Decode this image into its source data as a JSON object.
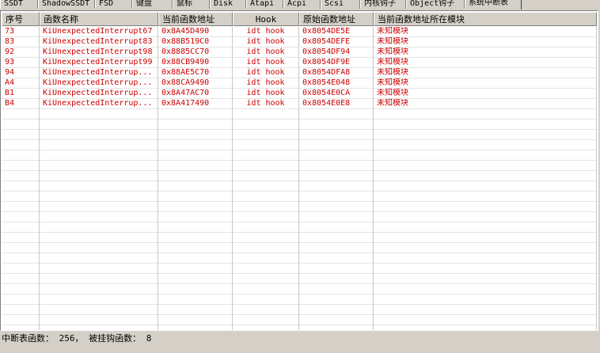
{
  "tabs": [
    {
      "label": "SSDT",
      "active": false
    },
    {
      "label": "ShadowSSDT",
      "active": false
    },
    {
      "label": "FSD",
      "active": false
    },
    {
      "label": "键盘",
      "active": false
    },
    {
      "label": "鼠标",
      "active": false
    },
    {
      "label": "Disk",
      "active": false
    },
    {
      "label": "Atapi",
      "active": false
    },
    {
      "label": "Acpi",
      "active": false
    },
    {
      "label": "Scsi",
      "active": false
    },
    {
      "label": "内核钩子",
      "active": false
    },
    {
      "label": "Object钩子",
      "active": false
    },
    {
      "label": "系统中断表",
      "active": true
    }
  ],
  "table": {
    "columns": [
      "序号",
      "函数名称",
      "当前函数地址",
      "Hook",
      "原始函数地址",
      "当前函数地址所在模块"
    ],
    "rows": [
      [
        "73",
        "KiUnexpectedInterrupt67",
        "0x8A45D490",
        "idt hook",
        "0x8054DE5E",
        "未知模块"
      ],
      [
        "83",
        "KiUnexpectedInterrupt83",
        "0x88B519C0",
        "idt hook",
        "0x8054DEFE",
        "未知模块"
      ],
      [
        "92",
        "KiUnexpectedInterrupt98",
        "0x8885CC70",
        "idt hook",
        "0x8054DF94",
        "未知模块"
      ],
      [
        "93",
        "KiUnexpectedInterrupt99",
        "0x88CB9490",
        "idt hook",
        "0x8054DF9E",
        "未知模块"
      ],
      [
        "94",
        "KiUnexpectedInterrup...",
        "0x88AE5C70",
        "idt hook",
        "0x8054DFA8",
        "未知模块"
      ],
      [
        "A4",
        "KiUnexpectedInterrup...",
        "0x88CA9490",
        "idt hook",
        "0x8054E048",
        "未知模块"
      ],
      [
        "B1",
        "KiUnexpectedInterrup...",
        "0x8A47AC70",
        "idt hook",
        "0x8054E0CA",
        "未知模块"
      ],
      [
        "B4",
        "KiUnexpectedInterrup...",
        "0x8A417490",
        "idt hook",
        "0x8054E0E8",
        "未知模块"
      ]
    ]
  },
  "status": {
    "text": "中断表函数： 256， 被挂钩函数： 8"
  },
  "colors": {
    "row_text": "#cc0000",
    "background": "#d4d0c8"
  }
}
